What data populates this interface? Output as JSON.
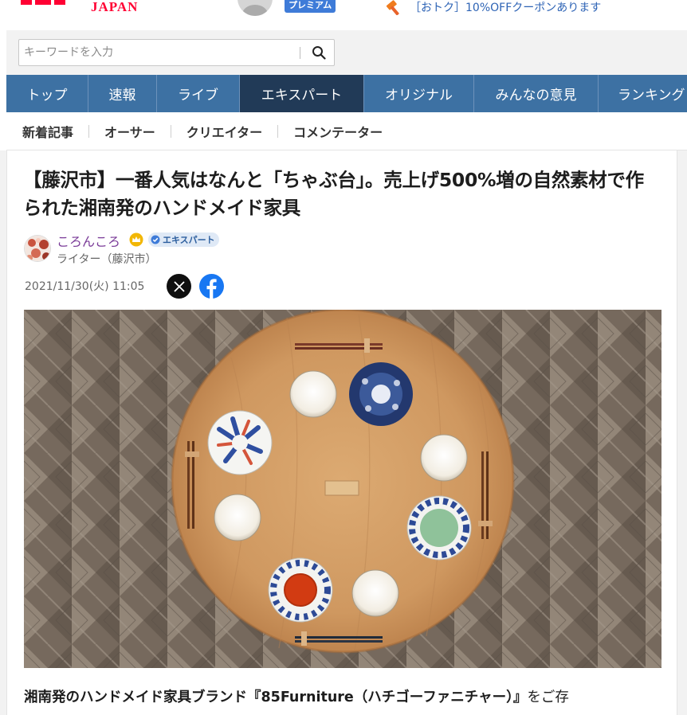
{
  "header": {
    "logo_text": "JAPAN",
    "premium_label": "プレミアム",
    "coupon_text": "［おトク］10%OFFクーポンあります"
  },
  "search": {
    "placeholder": "キーワードを入力",
    "value": ""
  },
  "main_nav": {
    "tabs": [
      {
        "label": "トップ"
      },
      {
        "label": "速報"
      },
      {
        "label": "ライブ"
      },
      {
        "label": "エキスパート"
      },
      {
        "label": "オリジナル"
      },
      {
        "label": "みんなの意見"
      },
      {
        "label": "ランキング"
      }
    ],
    "active_index": 3
  },
  "sub_nav": {
    "items": [
      {
        "label": "新着記事"
      },
      {
        "label": "オーサー"
      },
      {
        "label": "クリエイター"
      },
      {
        "label": "コメンテーター"
      }
    ]
  },
  "article": {
    "title": "【藤沢市】一番人気はなんと「ちゃぶ台」。売上げ500%増の自然素材で作られた湘南発のハンドメイド家具",
    "author": {
      "name": "ころんころ",
      "badge": "エキスパート",
      "role": "ライター（藤沢市）"
    },
    "date": "2021/11/30(火) 11:05",
    "lead_bold": "湘南発のハンドメイド家具ブランド『85Furniture（ハチゴーファニチャー）』",
    "lead_rest": "をご存"
  },
  "colors": {
    "brand_red": "#ff0033",
    "nav_blue": "#3d71a3",
    "nav_active": "#213a57",
    "author_purple": "#7a3b98",
    "link_blue": "#2d63b5"
  },
  "icons": [
    "hammer-icon",
    "search-icon",
    "crown-icon",
    "verified-icon",
    "x-icon",
    "facebook-icon"
  ]
}
